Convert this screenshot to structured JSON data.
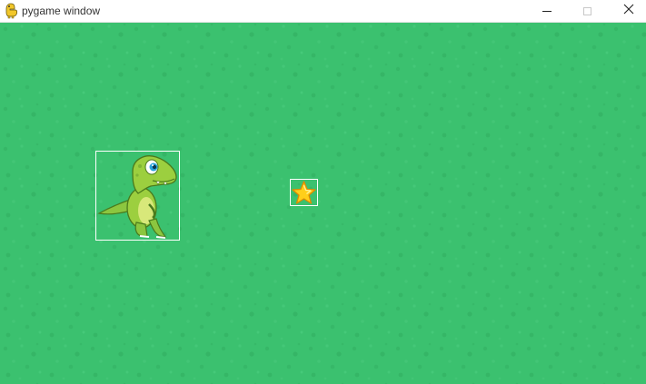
{
  "window": {
    "title": "pygame window",
    "app_icon": "python-icon",
    "controls": {
      "minimize_icon": "minimize-icon",
      "maximize_icon": "maximize-icon",
      "close_icon": "close-icon"
    }
  },
  "game": {
    "background_color": "#3bc16f",
    "sprites": [
      {
        "name": "dinosaur",
        "icon": "dinosaur-sprite",
        "outlined": true
      },
      {
        "name": "star",
        "icon": "star-icon",
        "outlined": true
      }
    ]
  }
}
